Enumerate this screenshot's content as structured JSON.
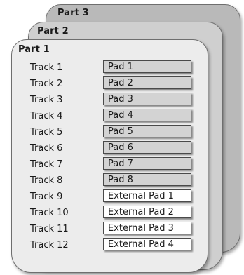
{
  "parts": [
    {
      "title": "Part 3"
    },
    {
      "title": "Part 2"
    },
    {
      "title": "Part 1",
      "rows": [
        {
          "track": "Track 1",
          "pad": "Pad 1"
        },
        {
          "track": "Track 2",
          "pad": "Pad 2"
        },
        {
          "track": "Track 3",
          "pad": "Pad 3"
        },
        {
          "track": "Track 4",
          "pad": "Pad 4"
        },
        {
          "track": "Track 5",
          "pad": "Pad 5"
        },
        {
          "track": "Track 6",
          "pad": "Pad 6"
        },
        {
          "track": "Track 7",
          "pad": "Pad 7"
        },
        {
          "track": "Track 8",
          "pad": "Pad 8"
        },
        {
          "track": "Track 9",
          "pad": "External Pad 1"
        },
        {
          "track": "Track 10",
          "pad": "External Pad 2"
        },
        {
          "track": "Track 11",
          "pad": "External Pad 3"
        },
        {
          "track": "Track 12",
          "pad": "External Pad 4"
        }
      ]
    }
  ],
  "colors": {
    "internal_pad": "#d3d3d3",
    "external_pad": "#ffffff",
    "part1_card": "#ececec",
    "part2_card": "#cfcfcf",
    "part3_card": "#b9b9b9"
  }
}
